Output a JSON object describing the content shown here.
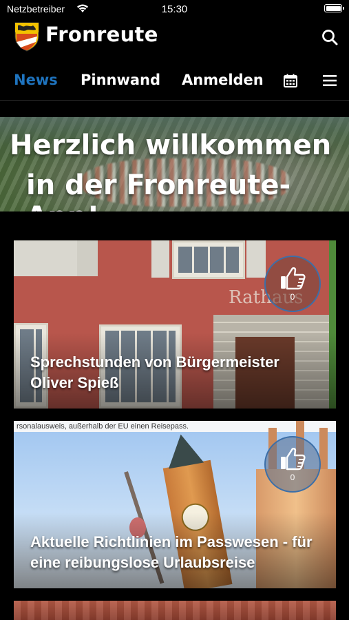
{
  "status_bar": {
    "carrier": "Netzbetreiber",
    "time": "15:30"
  },
  "header": {
    "title": "Fronreute",
    "logo_icon": "coat-of-arms-icon",
    "search_icon": "search-icon"
  },
  "nav": {
    "items": [
      {
        "label": "News",
        "active": true
      },
      {
        "label": "Pinnwand",
        "active": false
      },
      {
        "label": "Anmelden",
        "active": false
      }
    ],
    "calendar_icon": "calendar-icon",
    "menu_icon": "hamburger-menu-icon",
    "active_color": "#1e73be"
  },
  "banner": {
    "line1": "Herzlich willkommen",
    "line2": "in der Fronreute-App!"
  },
  "cards": [
    {
      "title_line1": "Sprechstunden von Bürgermeister",
      "title_line2": "Oliver Spieß",
      "like_count": "0",
      "image_text": "Rathaus"
    },
    {
      "title_line1": "Aktuelle Richtlinien im Passwesen - für",
      "title_line2": "eine reibungslose Urlaubsreise",
      "like_count": "0",
      "image_text": "rsonalausweis, außerhalb der EU einen Reisepass."
    }
  ]
}
